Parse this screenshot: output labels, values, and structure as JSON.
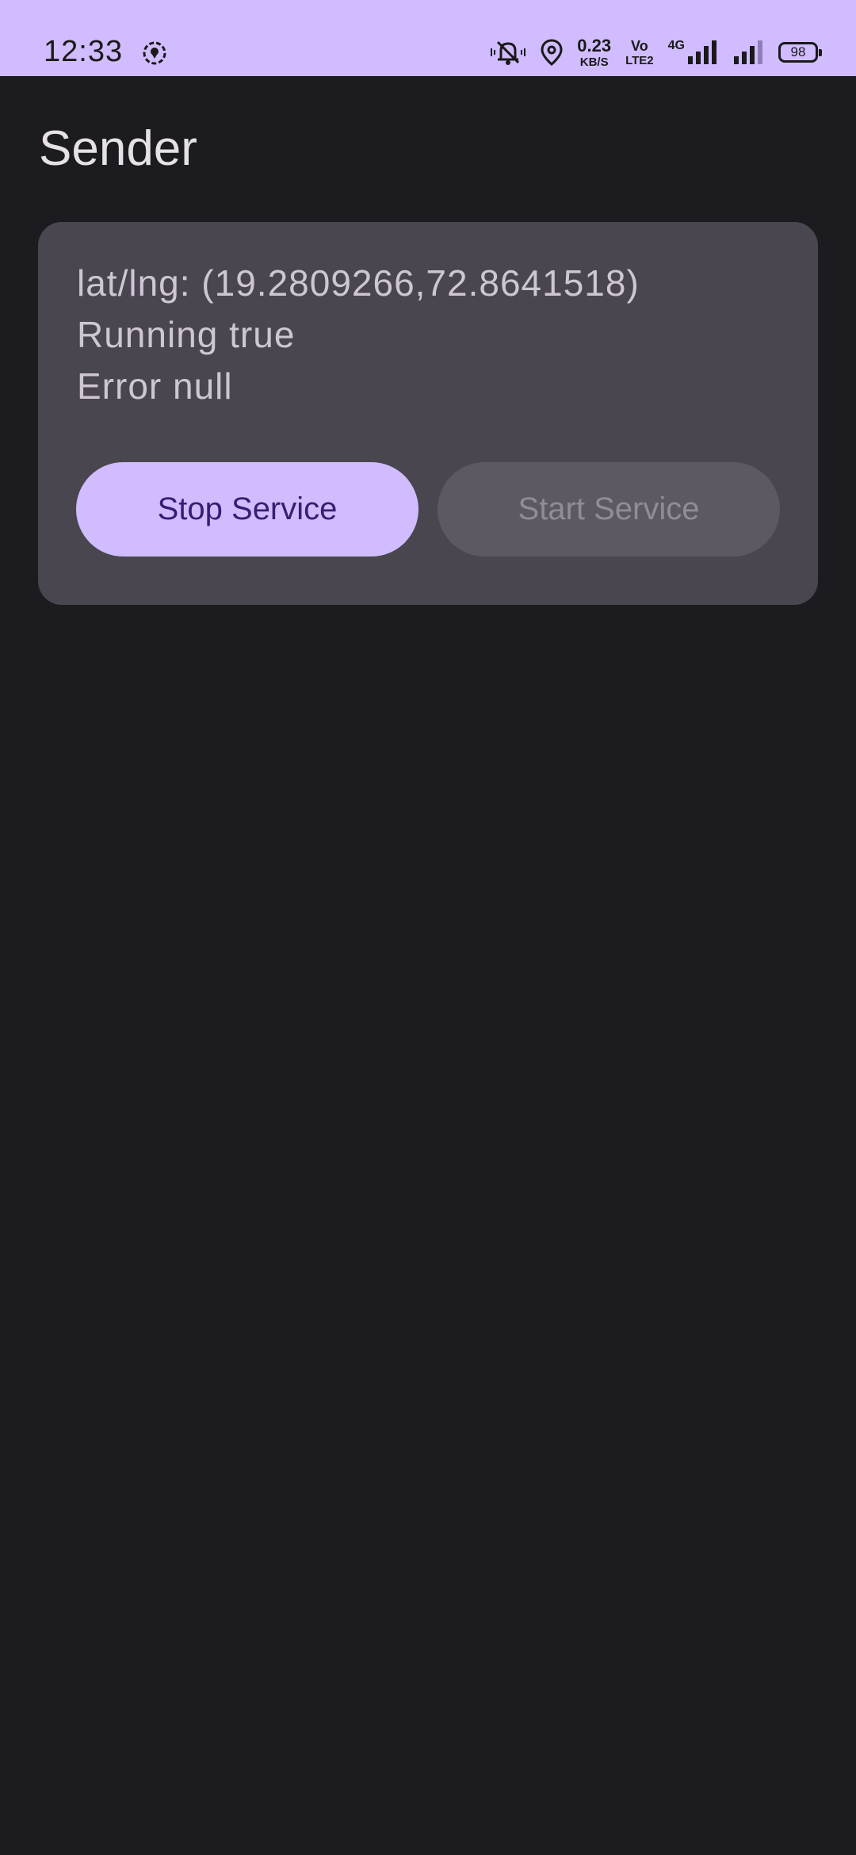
{
  "status_bar": {
    "time": "12:33",
    "net_speed_value": "0.23",
    "net_speed_unit": "KB/S",
    "volte_top": "Vo",
    "volte_bottom": "LTE2",
    "network_type": "4G",
    "battery": "98",
    "icons": [
      "location-circle-icon",
      "mute-bell-icon",
      "location-pin-icon",
      "signal-icon",
      "signal-icon-2"
    ]
  },
  "app": {
    "title": "Sender"
  },
  "card": {
    "latlng": "lat/lng: (19.2809266,72.8641518)",
    "running": "Running true",
    "error": "Error null",
    "stop_label": "Stop Service",
    "start_label": "Start Service"
  },
  "colors": {
    "background": "#1c1b20",
    "status_bar": "#d0bcfe",
    "card": "#4a4650",
    "primary_button": "#d0bcfe",
    "primary_button_text": "#381e72",
    "disabled_button": "#5c5962",
    "disabled_text": "#918d98"
  }
}
